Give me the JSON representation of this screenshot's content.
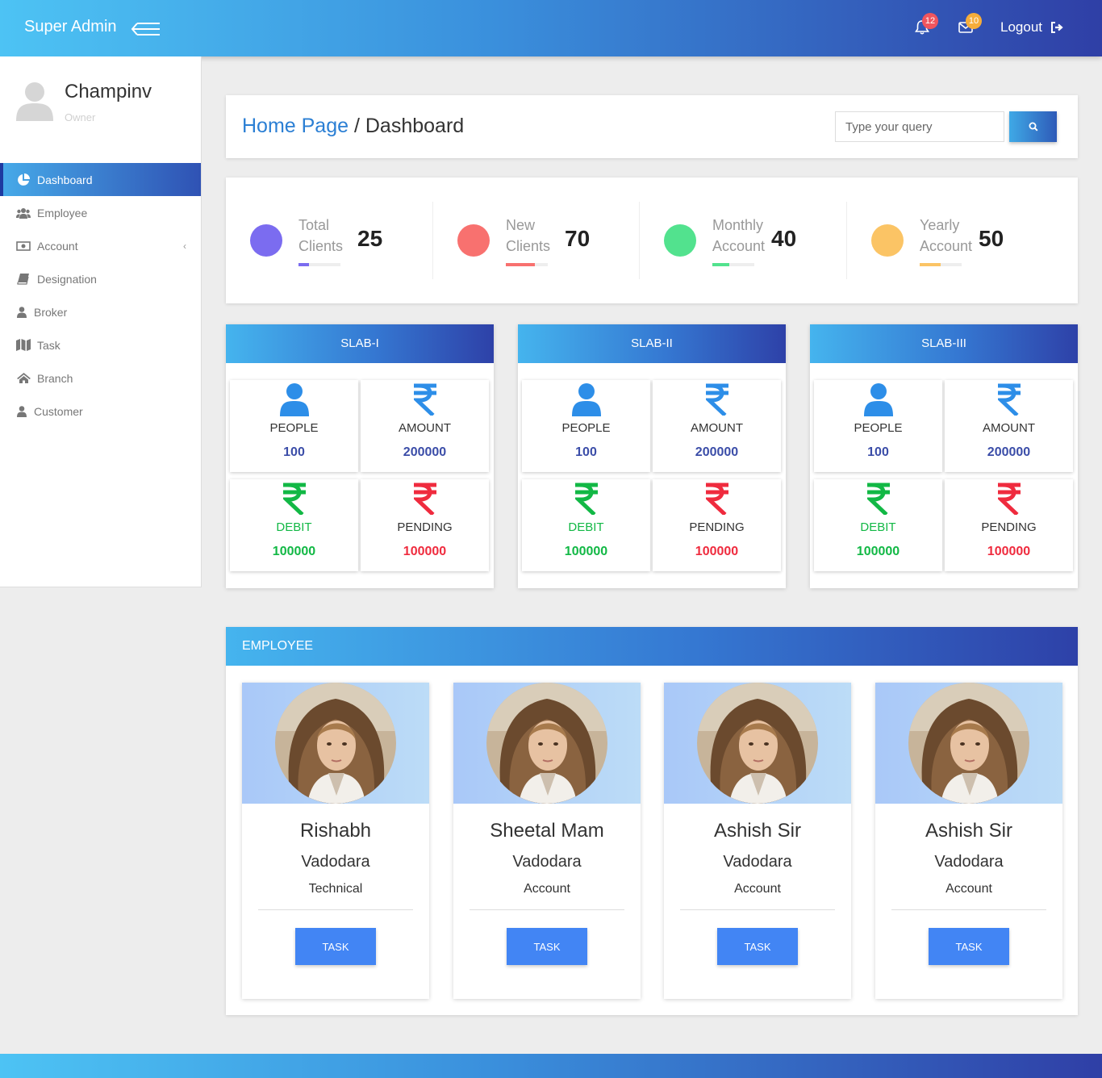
{
  "header": {
    "brand": "Super Admin",
    "notifications_count": "12",
    "messages_count": "10",
    "logout_label": "Logout"
  },
  "sidebar": {
    "profile": {
      "name": "Champinv",
      "role": "Owner"
    },
    "items": [
      {
        "label": "Dashboard",
        "icon": "pie-chart-icon",
        "active": true
      },
      {
        "label": "Employee",
        "icon": "users-icon"
      },
      {
        "label": "Account",
        "icon": "money-icon",
        "has_submenu": true
      },
      {
        "label": "Designation",
        "icon": "book-icon"
      },
      {
        "label": "Broker",
        "icon": "user-icon"
      },
      {
        "label": "Task",
        "icon": "map-icon"
      },
      {
        "label": "Branch",
        "icon": "home-icon"
      },
      {
        "label": "Customer",
        "icon": "user-icon"
      }
    ]
  },
  "breadcrumb": {
    "home": "Home Page",
    "separator": " / ",
    "current": "Dashboard"
  },
  "search": {
    "placeholder": "Type your query"
  },
  "stats": [
    {
      "label_line1": "Total",
      "label_line2": "Clients",
      "value": "25",
      "color": "#7b6cf0",
      "progress": 0.25
    },
    {
      "label_line1": "New",
      "label_line2": "Clients",
      "value": "70",
      "color": "#f8716f",
      "progress": 0.7
    },
    {
      "label_line1": "Monthly",
      "label_line2": "Account",
      "value": "40",
      "color": "#52e28e",
      "progress": 0.4
    },
    {
      "label_line1": "Yearly",
      "label_line2": "Account",
      "value": "50",
      "color": "#fbc465",
      "progress": 0.5
    }
  ],
  "slabs": [
    {
      "title": "SLAB-I",
      "people_label": "PEOPLE",
      "people_value": "100",
      "amount_label": "AMOUNT",
      "amount_value": "200000",
      "debit_label": "DEBIT",
      "debit_value": "100000",
      "pending_label": "PENDING",
      "pending_value": "100000"
    },
    {
      "title": "SLAB-II",
      "people_label": "PEOPLE",
      "people_value": "100",
      "amount_label": "AMOUNT",
      "amount_value": "200000",
      "debit_label": "DEBIT",
      "debit_value": "100000",
      "pending_label": "PENDING",
      "pending_value": "100000"
    },
    {
      "title": "SLAB-III",
      "people_label": "PEOPLE",
      "people_value": "100",
      "amount_label": "AMOUNT",
      "amount_value": "200000",
      "debit_label": "DEBIT",
      "debit_value": "100000",
      "pending_label": "PENDING",
      "pending_value": "100000"
    }
  ],
  "slab_colors": {
    "people": "#2d8ee8",
    "amount": "#2d8ee8",
    "debit": "#12b845",
    "pending": "#ef2b3e",
    "value_blue": "#3b4da8"
  },
  "employee_section": {
    "title": "EMPLOYEE",
    "cards": [
      {
        "name": "Rishabh",
        "city": "Vadodara",
        "department": "Technical",
        "button": "TASK"
      },
      {
        "name": "Sheetal Mam",
        "city": "Vadodara",
        "department": "Account",
        "button": "TASK"
      },
      {
        "name": "Ashish Sir",
        "city": "Vadodara",
        "department": "Account",
        "button": "TASK"
      },
      {
        "name": "Ashish Sir",
        "city": "Vadodara",
        "department": "Account",
        "button": "TASK"
      }
    ]
  }
}
